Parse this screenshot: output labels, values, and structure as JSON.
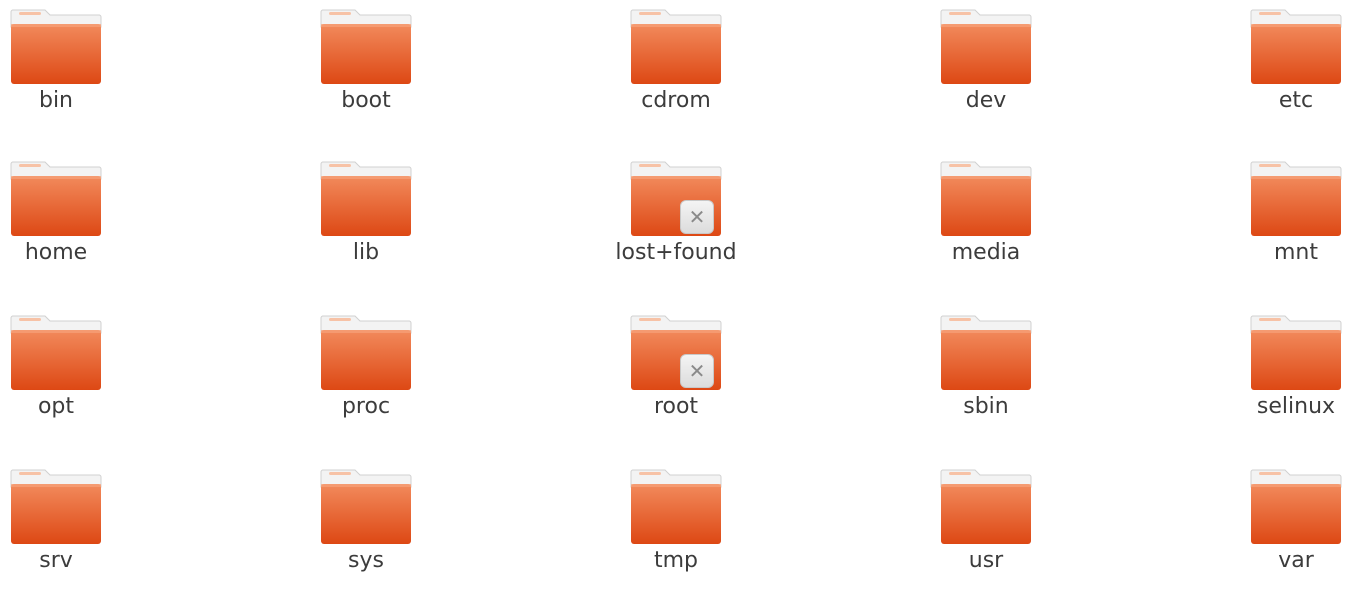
{
  "icons": {
    "folder": "folder-icon",
    "locked_emblem": "unreadable-emblem-icon"
  },
  "colors": {
    "folder_top": "#f28a5c",
    "folder_bottom": "#dd4814",
    "folder_tab": "#f7c2a6",
    "label": "#3c3c3c",
    "background": "#ffffff"
  },
  "emblem_glyph": "✕",
  "items": [
    {
      "label": "bin",
      "locked": false
    },
    {
      "label": "boot",
      "locked": false
    },
    {
      "label": "cdrom",
      "locked": false
    },
    {
      "label": "dev",
      "locked": false
    },
    {
      "label": "etc",
      "locked": false
    },
    {
      "label": "home",
      "locked": false
    },
    {
      "label": "lib",
      "locked": false
    },
    {
      "label": "lost+found",
      "locked": true
    },
    {
      "label": "media",
      "locked": false
    },
    {
      "label": "mnt",
      "locked": false
    },
    {
      "label": "opt",
      "locked": false
    },
    {
      "label": "proc",
      "locked": false
    },
    {
      "label": "root",
      "locked": true
    },
    {
      "label": "sbin",
      "locked": false
    },
    {
      "label": "selinux",
      "locked": false
    },
    {
      "label": "srv",
      "locked": false
    },
    {
      "label": "sys",
      "locked": false
    },
    {
      "label": "tmp",
      "locked": false
    },
    {
      "label": "usr",
      "locked": false
    },
    {
      "label": "var",
      "locked": false
    }
  ]
}
